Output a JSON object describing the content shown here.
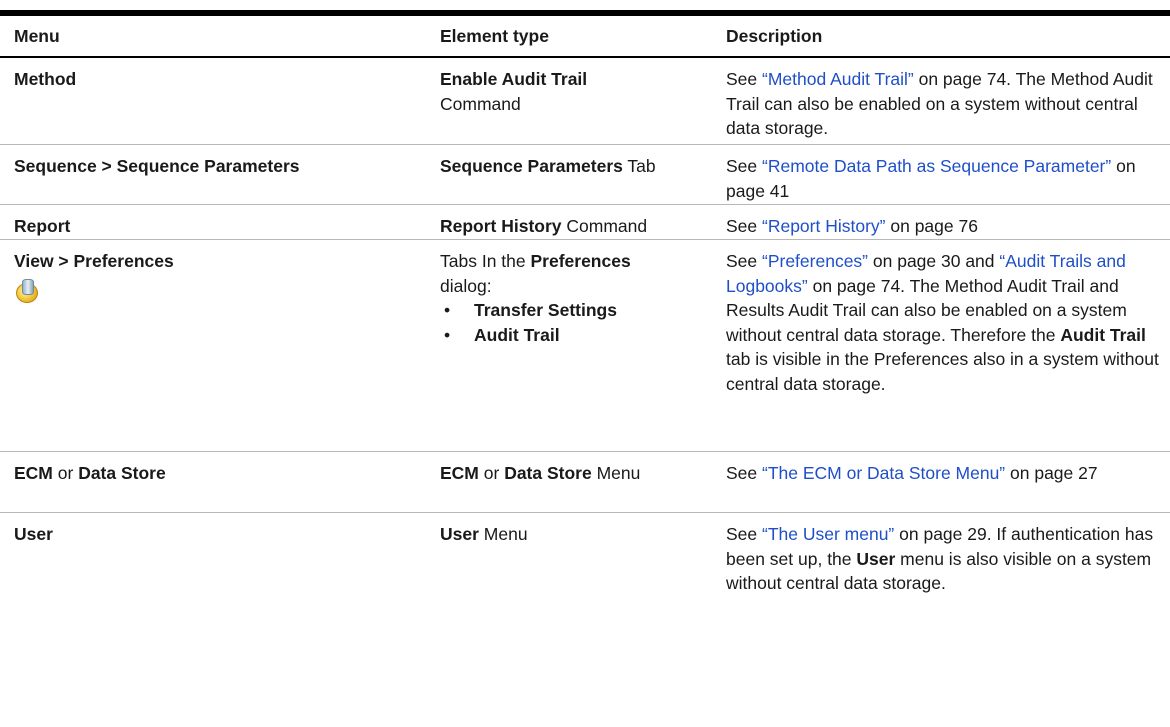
{
  "columns": {
    "menu": "Menu",
    "element_type": "Element type",
    "description": "Description"
  },
  "rows": [
    {
      "menu": "Method",
      "element_bold": "Enable Audit Trail",
      "element_rest": "Command",
      "desc": {
        "pre": "See ",
        "link": "“Method Audit Trail”",
        "post": " on page 74. The Method Audit Trail can also be enabled on a system without central data storage."
      }
    },
    {
      "menu": "Sequence > Sequence Parameters",
      "element_bold": "Sequence Parameters",
      "element_rest": " Tab",
      "desc": {
        "pre": "See ",
        "link": "“Remote Data Path as Sequence Parameter”",
        "post": " on page 41"
      }
    },
    {
      "menu": "Report",
      "element_bold": "Report History",
      "element_rest": " Command",
      "desc": {
        "pre": "See ",
        "link": "“Report History”",
        "post": " on page 76"
      }
    },
    {
      "menu": "View > Preferences",
      "icon": "preferences-icon",
      "element_pre": "Tabs In the ",
      "element_bold": "Preferences",
      "element_post": " dialog:",
      "bullets": [
        "Transfer Settings",
        "Audit Trail"
      ],
      "desc": {
        "pre": "See ",
        "link1": "“Preferences”",
        "mid1": " on page 30 and ",
        "link2": "“Audit Trails and Logbooks”",
        "mid2": " on page 74. The Method Audit Trail and Results Audit Trail can also be enabled on a system without central data storage. Therefore the ",
        "bold": "Audit Trail",
        "post": " tab is visible in the Preferences also in a system without central data storage."
      }
    },
    {
      "menu_bold1": "ECM",
      "menu_mid": " or ",
      "menu_bold2": "Data Store",
      "element_bold1": "ECM",
      "element_mid": " or ",
      "element_bold2": "Data Store",
      "element_rest": " Menu",
      "desc": {
        "pre": "See ",
        "link": "“The ECM or Data Store Menu”",
        "post": " on page 27"
      }
    },
    {
      "menu": "User",
      "element_bold": "User",
      "element_rest": " Menu",
      "desc": {
        "pre": "See ",
        "link": "“The User menu”",
        "mid": " on page 29. If authentication has been set up, the ",
        "bold": "User",
        "post": " menu is also visible on a system without central data storage."
      }
    }
  ],
  "colors": {
    "link": "#1f4fc8",
    "rule": "#000000"
  }
}
